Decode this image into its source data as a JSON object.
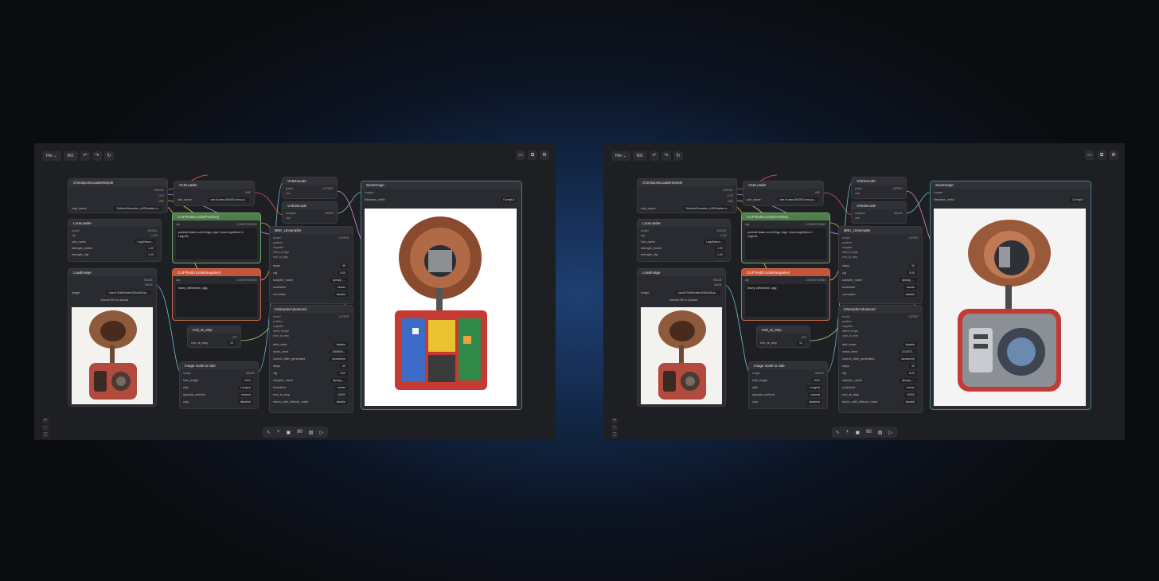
{
  "toolbar": {
    "file": "File",
    "file_caret": "⌄",
    "tab": "001",
    "undo": "↶",
    "redo": "↷",
    "refresh": "↻"
  },
  "toolbar_right": {
    "a": "▭",
    "b": "⧉",
    "c": "⚙"
  },
  "nodes": {
    "checkpoint": {
      "title": "CheckpointLoaderSimple",
      "outputs": [
        "MODEL",
        "CLIP",
        "VAE"
      ],
      "field_label": "ckpt_name",
      "field_value": "3dAnimCharacter_v20Realism.s..."
    },
    "vae_loader": {
      "title": "VAELoader",
      "output": "VAE",
      "field_label": "vae_name",
      "field_value": "vae-ft-mse-840000-ema-pr..."
    },
    "vae_encode": {
      "title": "VAEEncode",
      "inputs": [
        "pixels",
        "vae"
      ],
      "output": "LATENT"
    },
    "vae_decode": {
      "title": "VAEDecode",
      "inputs": [
        "samples",
        "vae"
      ],
      "output": "IMAGE"
    },
    "save_image": {
      "title": "SaveImage",
      "input": "images",
      "field_label": "filename_prefix",
      "field_value": "ComfyUI"
    },
    "lora_loader": {
      "title": "LoraLoader",
      "inputs": [
        "model",
        "clip"
      ],
      "outputs": [
        "MODEL",
        "CLIP"
      ],
      "fields": [
        {
          "label": "lora_name",
          "value": "LegoNew.s..."
        },
        {
          "label": "strength_model",
          "value": "1.00"
        },
        {
          "label": "strength_clip",
          "value": "1.00"
        }
      ]
    },
    "clip_pos": {
      "title": "CLIPTextEncode(Positive)",
      "input": "clip",
      "output": "CONDITIONING",
      "text": "portrait made out of lego, lego <lora:LegoNew:1> LegoXL"
    },
    "clip_neg": {
      "title": "CLIPTextEncode(Negative)",
      "input": "clip",
      "output": "CONDITIONING",
      "text": "blurry, deformed, ugly,"
    },
    "load_image": {
      "title": "LoadImage",
      "outputs": [
        "IMAGE",
        "MASK"
      ],
      "field_label": "image",
      "field_value": "<Aa4e70d8Wutter3D5Ad0Eac...",
      "upload": "choose file to upload"
    },
    "ksampler": {
      "title": "BNK_Unsampler",
      "inputs": [
        "model",
        "positive",
        "negative",
        "latent_image",
        "end_at_step"
      ],
      "output": "LATENT",
      "fields": [
        {
          "label": "steps",
          "value": "30"
        },
        {
          "label": "cfg",
          "value": "5.00"
        },
        {
          "label": "sampler_name",
          "value": "dpmpp_..."
        },
        {
          "label": "scheduler",
          "value": "karras"
        },
        {
          "label": "normalize",
          "value": "disable"
        }
      ]
    },
    "ksampler_adv": {
      "title": "KSamplerAdvanced",
      "inputs": [
        "model",
        "positive",
        "negative",
        "latent_image",
        "start_at_step"
      ],
      "output": "LATENT"
    },
    "end_step": {
      "title": "end_at_step",
      "output": "INT",
      "field_label": "end_at_step"
    },
    "scale": {
      "title": "Image scale to side",
      "input": "image",
      "output": "IMAGE",
      "fields": [
        {
          "label": "side_length",
          "value": "1024"
        },
        {
          "label": "side",
          "value": "Longest"
        },
        {
          "label": "upscale_method",
          "value": "nearest"
        },
        {
          "label": "crop",
          "value": "disabled"
        }
      ]
    }
  },
  "left": {
    "end_step_value": "10",
    "ksampler_adv_fields": [
      {
        "label": "add_noise",
        "value": "disable"
      },
      {
        "label": "noise_seed",
        "value": "1083640..."
      },
      {
        "label": "control_after_generated",
        "value": "randomize"
      },
      {
        "label": "steps",
        "value": "30"
      },
      {
        "label": "cfg",
        "value": "9.00"
      },
      {
        "label": "sampler_name",
        "value": "dpmpp_..."
      },
      {
        "label": "scheduler",
        "value": "karras"
      },
      {
        "label": "end_at_step",
        "value": "10000"
      },
      {
        "label": "return_with_leftover_noise",
        "value": "disable"
      }
    ]
  },
  "right": {
    "end_step_value": "12",
    "ksampler_adv_fields": [
      {
        "label": "add_noise",
        "value": "disable"
      },
      {
        "label": "noise_seed",
        "value": "1113973..."
      },
      {
        "label": "control_after_generated",
        "value": "randomize"
      },
      {
        "label": "steps",
        "value": "30"
      },
      {
        "label": "cfg",
        "value": "8.00"
      },
      {
        "label": "sampler_name",
        "value": "dpmpp_..."
      },
      {
        "label": "scheduler",
        "value": "karras"
      },
      {
        "label": "end_at_step",
        "value": "10000"
      },
      {
        "label": "return_with_leftover_noise",
        "value": "disable"
      }
    ]
  },
  "bottombar": {
    "select": "↖",
    "add": "+",
    "img": "▣",
    "num": "90",
    "film": "▤",
    "run": "▷"
  },
  "zoom": {
    "in": "+",
    "out": "−",
    "fit": "⛶",
    "dot": "●"
  },
  "colors": {
    "wire_model": "#b59df0",
    "wire_clip": "#f0d24a",
    "wire_vae": "#e35d5d",
    "wire_cond": "#f0a05a",
    "wire_latent": "#e889c8",
    "wire_image": "#6bc1d9",
    "pos_header": "#4f7e4b",
    "neg_header": "#c4553a"
  }
}
